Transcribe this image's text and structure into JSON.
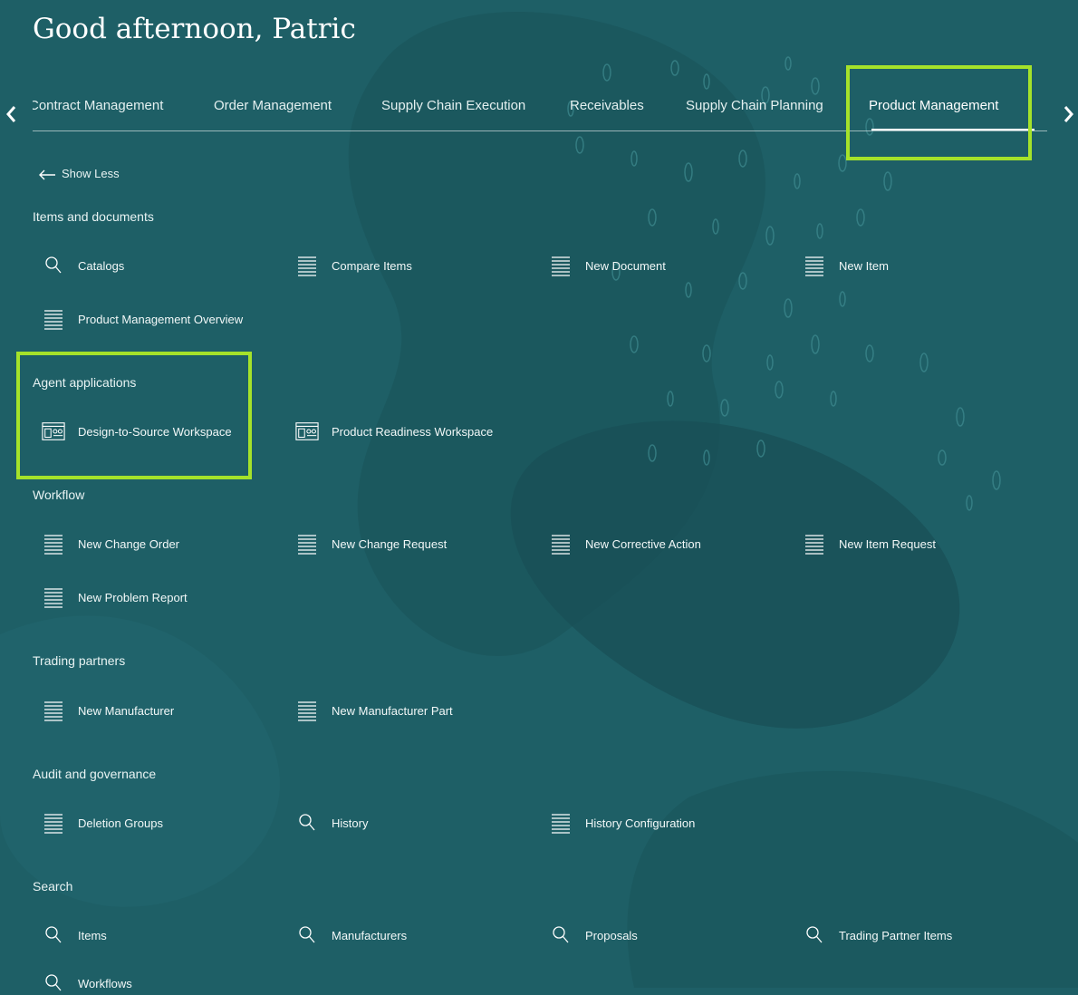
{
  "greeting": "Good afternoon, Patric",
  "tabs": [
    {
      "label": "Contract Management"
    },
    {
      "label": "Order Management"
    },
    {
      "label": "Supply Chain Execution"
    },
    {
      "label": "Receivables"
    },
    {
      "label": "Supply Chain Planning"
    },
    {
      "label": "Product Management"
    }
  ],
  "active_tab": "Product Management",
  "show_less": "Show Less",
  "sections": {
    "items_documents": {
      "title": "Items and documents",
      "items": [
        {
          "label": "Catalogs",
          "icon": "search-icon"
        },
        {
          "label": "Compare Items",
          "icon": "list-icon"
        },
        {
          "label": "New Document",
          "icon": "list-icon"
        },
        {
          "label": "New Item",
          "icon": "list-icon"
        },
        {
          "label": "Product Management Overview",
          "icon": "list-icon"
        }
      ]
    },
    "agent_apps": {
      "title": "Agent applications",
      "items": [
        {
          "label": "Design-to-Source Workspace",
          "icon": "workspace-icon"
        },
        {
          "label": "Product Readiness Workspace",
          "icon": "workspace-icon"
        }
      ]
    },
    "workflow": {
      "title": "Workflow",
      "items": [
        {
          "label": "New Change Order",
          "icon": "list-icon"
        },
        {
          "label": "New Change Request",
          "icon": "list-icon"
        },
        {
          "label": "New Corrective Action",
          "icon": "list-icon"
        },
        {
          "label": "New Item Request",
          "icon": "list-icon"
        },
        {
          "label": "New Problem Report",
          "icon": "list-icon"
        }
      ]
    },
    "trading_partners": {
      "title": "Trading partners",
      "items": [
        {
          "label": "New Manufacturer",
          "icon": "list-icon"
        },
        {
          "label": "New Manufacturer Part",
          "icon": "list-icon"
        }
      ]
    },
    "audit": {
      "title": "Audit and governance",
      "items": [
        {
          "label": "Deletion Groups",
          "icon": "list-icon"
        },
        {
          "label": "History",
          "icon": "search-icon"
        },
        {
          "label": "History Configuration",
          "icon": "list-icon"
        }
      ]
    },
    "search": {
      "title": "Search",
      "items": [
        {
          "label": "Items",
          "icon": "search-icon"
        },
        {
          "label": "Manufacturers",
          "icon": "search-icon"
        },
        {
          "label": "Proposals",
          "icon": "search-icon"
        },
        {
          "label": "Trading Partner Items",
          "icon": "search-icon"
        },
        {
          "label": "Workflows",
          "icon": "search-icon"
        }
      ]
    }
  },
  "colors": {
    "background": "#1e5f66",
    "highlight": "#a5e22a"
  }
}
